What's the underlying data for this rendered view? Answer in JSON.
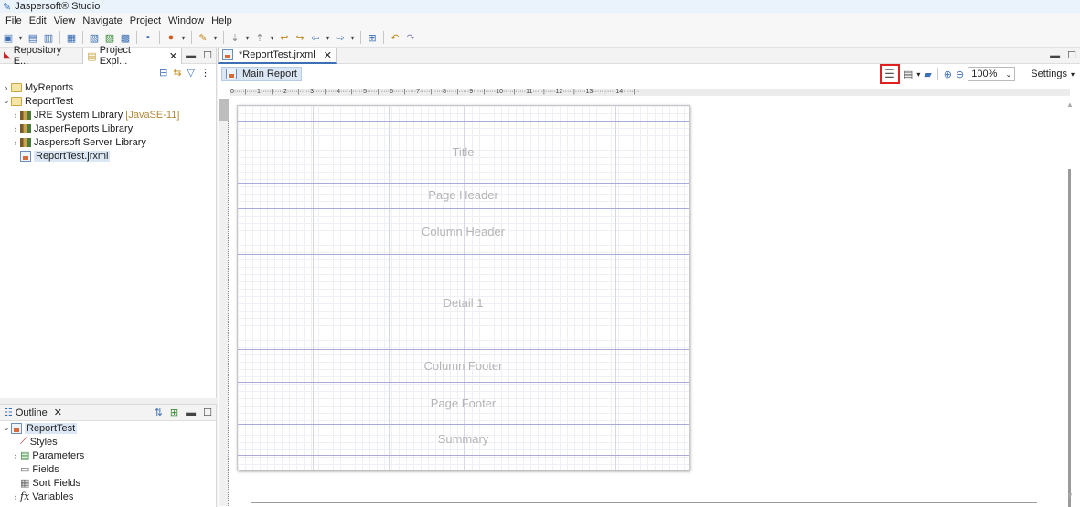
{
  "app": {
    "title": "Jaspersoft® Studio"
  },
  "menu": [
    "File",
    "Edit",
    "View",
    "Navigate",
    "Project",
    "Window",
    "Help"
  ],
  "left_tabs": {
    "repository": "Repository E...",
    "project": "Project Expl..."
  },
  "tree": {
    "myreports": "MyReports",
    "reporttest": "ReportTest",
    "jre": "JRE System Library",
    "jre_suffix": "[JavaSE-11]",
    "jasperreports": "JasperReports Library",
    "jaspersoft_server": "Jaspersoft Server Library",
    "jrxml": "ReportTest.jrxml"
  },
  "outline": {
    "tab": "Outline",
    "root": "ReportTest",
    "items": [
      "Styles",
      "Parameters",
      "Fields",
      "Sort Fields",
      "Variables"
    ]
  },
  "editor": {
    "tab": "*ReportTest.jrxml",
    "main_report": "Main Report",
    "zoom": "100%",
    "settings": "Settings"
  },
  "bands": {
    "title": "Title",
    "page_header": "Page Header",
    "column_header": "Column Header",
    "detail": "Detail 1",
    "column_footer": "Column Footer",
    "page_footer": "Page Footer",
    "summary": "Summary"
  },
  "ruler": "0·····|·····1·····|·····2·····|·····3·····|·····4·····|·····5·····|·····6·····|·····7·····|·····8·····|·····9·····|·····10·····|·····11·····|·····12·····|·····13·····|·····14·····|··"
}
